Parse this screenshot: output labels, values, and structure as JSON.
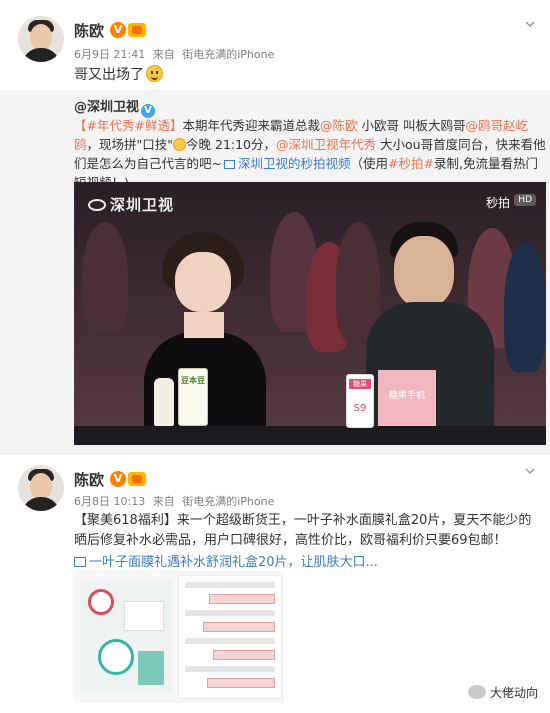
{
  "post1": {
    "user_name": "陈欧",
    "verified": "V",
    "date": "6月9日 21:41",
    "source_prefix": "来自",
    "source": "街电充满的iPhone",
    "text": "哥又出场了",
    "repost": {
      "user": "@深圳卫视",
      "verified": "V",
      "text_parts": {
        "tag1": "【#年代秀#鲜透】",
        "t1": "本期年代秀迎来霸道总裁",
        "mention1": "@陈欧",
        "t2": "小欧哥 叫板大鸥哥",
        "mention2": "@鸥哥赵屹鸥",
        "t3": "，现场拼\"口技\"",
        "t4": "今晚 21:10分，",
        "mention3": "@深圳卫视年代秀",
        "t5": "大小ou哥首度同台，快来看他们是怎么为自己代言的吧~",
        "video_link": "深圳卫视的秒拍视频",
        "t6": "（使用",
        "tag2": "#秒拍#",
        "t7": "录制,免流量看热门短视频！)"
      },
      "video": {
        "channel_logo": "深圳卫视",
        "platform_logo": "秒拍",
        "hd_badge": "HD",
        "phone_card_title": "糖果",
        "phone_card_model": "S9",
        "banner_text": "糖果手机",
        "bottle_label": "豆本豆"
      }
    }
  },
  "post2": {
    "user_name": "陈欧",
    "verified": "V",
    "date": "6月8日 10:13",
    "source_prefix": "来自",
    "source": "街电充满的iPhone",
    "text": "【聚美618福利】来一个超级断货王，一叶子补水面膜礼盒20片，夏天不能少的晒后修复补水必需品，用户口碑很好，高性价比，欧哥福利价只要69包邮！",
    "link_text": "一叶子面膜礼遇补水舒润礼盒20片，让肌肤大口..."
  },
  "watermark": "大佬动向",
  "colors": {
    "accent": "#eb7350",
    "link": "#3a7fc6",
    "verified": "#ff8200",
    "meta": "#808080"
  }
}
